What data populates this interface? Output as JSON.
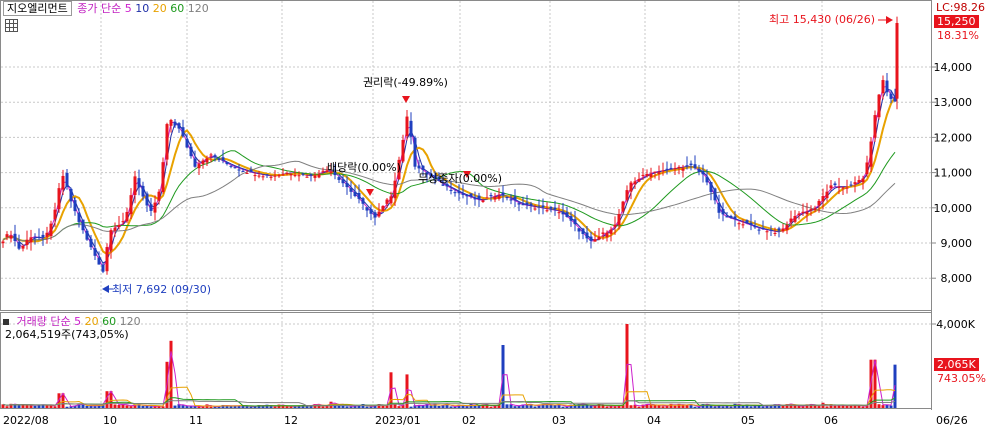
{
  "header": {
    "stock_name": "지오엘리먼트",
    "price_ma_label": "종가 단순",
    "ma_periods": [
      "5",
      "10",
      "20",
      "60",
      "120"
    ],
    "volume_label": "거래량 단순",
    "volume_ma_periods": [
      "5",
      "20",
      "60",
      "120"
    ],
    "volume_info": "2,064,519주(743,05%)"
  },
  "right_axis": {
    "lc_label": "LC:98.26",
    "price_labels": [
      "14,000",
      "13,000",
      "12,000",
      "11,000",
      "10,000",
      "9,000",
      "8,000"
    ],
    "current_price": "15,250",
    "current_change": "18.31%",
    "volume_labels": [
      "4,000K"
    ],
    "current_volume": "2,065K",
    "current_volume_ratio": "743.05%"
  },
  "annotations": {
    "high": "최고 15,430 (06/26)",
    "low": "최저 7,692 (09/30)",
    "rights": "권리락(-49.89%)",
    "dividend": "배당락(0.00%)",
    "bonus": "무상증자(0.00%)"
  },
  "x_axis": {
    "labels": [
      "2022/08",
      "10",
      "11",
      "12",
      "2023/01",
      "02",
      "03",
      "04",
      "05",
      "06",
      "06/26"
    ]
  },
  "colors": {
    "up": "#e8141d",
    "down": "#1f3fbf",
    "ma5": "#cc1fcc",
    "ma10": "#2030a8",
    "ma20": "#e8a200",
    "ma60": "#1f9a1f",
    "ma120": "#808080"
  },
  "chart_data": [
    {
      "type": "candlestick",
      "title": "지오엘리먼트",
      "y_unit": "KRW",
      "ylim": [
        7400,
        15600
      ],
      "grid": true,
      "series": [
        {
          "name": "종가",
          "kind": "ohlc",
          "points": [
            {
              "x": "2022/08",
              "close": 9000
            },
            {
              "x": "2022/09",
              "close": 9500
            },
            {
              "x": "2022/09/30",
              "low": 7692,
              "close": 8200
            },
            {
              "x": "10",
              "close": 9600
            },
            {
              "x": "11",
              "close": 12500
            },
            {
              "x": "12",
              "close": 11000
            },
            {
              "x": "2023/01",
              "close": 12700
            },
            {
              "x": "02",
              "close": 10300
            },
            {
              "x": "03",
              "close": 9200
            },
            {
              "x": "04",
              "close": 11000
            },
            {
              "x": "05",
              "close": 9300
            },
            {
              "x": "06",
              "close": 13200
            },
            {
              "x": "06/26",
              "high": 15430,
              "close": 15250
            }
          ]
        },
        {
          "name": "5"
        },
        {
          "name": "10"
        },
        {
          "name": "20"
        },
        {
          "name": "60"
        },
        {
          "name": "120"
        }
      ]
    },
    {
      "type": "bar",
      "title": "거래량",
      "y_unit": "주",
      "ylim": [
        0,
        4300000
      ],
      "series": [
        {
          "name": "거래량",
          "points": [
            {
              "x": "10",
              "y": 2200000
            },
            {
              "x": "2023/01",
              "y": 1600000
            },
            {
              "x": "04",
              "y": 4000000
            },
            {
              "x": "06/26",
              "y": 2064519
            }
          ]
        },
        {
          "name": "5"
        },
        {
          "name": "20"
        },
        {
          "name": "60"
        },
        {
          "name": "120"
        }
      ]
    }
  ]
}
